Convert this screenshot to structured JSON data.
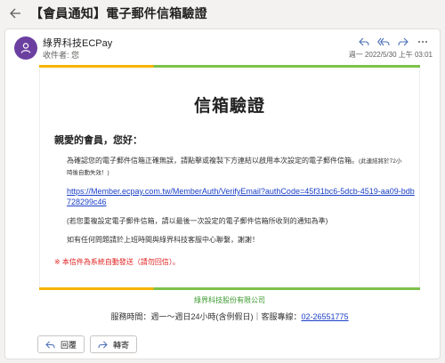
{
  "header": {
    "subject": "【會員通知】電子郵件信箱驗證"
  },
  "message": {
    "sender": "綠界科技ECPay",
    "recipient": "收件者: 您",
    "timestamp": "週一 2022/5/30 上午 03:01",
    "avatar_color": "#6b3fa0"
  },
  "email": {
    "title": "信箱驗證",
    "greeting": "親愛的會員，您好：",
    "paragraph1": "為確認您的電子郵件信箱正確無誤，請點擊或複製下方連結以啟用本次設定的電子郵件信箱。",
    "paragraph1_note": "(此連結將於72小時後自動失效！)",
    "verify_link": "https://Member.ecpay.com.tw/MemberAuth/VerifyEmail?authCode=45f31bc6-5dcb-4519-aa09-bdb728299c46",
    "paragraph2": "(若您重複設定電子郵件信箱，請以最後一次設定的電子郵件信箱所收到的通知為準)",
    "paragraph3": "如有任何問題請於上班時間與綠界科技客服中心聯繫，謝謝！",
    "notice": "※ 本信件為系統自動發送（請勿回信）。",
    "company": "綠界科技股份有限公司",
    "service_hours": "服務時間：週一～週日24小時(含例假日)｜客服專線：",
    "phone": "02-26551775",
    "accent_yellow": "#f5b400",
    "accent_green": "#7cc24a"
  },
  "buttons": {
    "reply": "回覆",
    "forward": "轉寄"
  },
  "icons": {
    "back": "arrow-left-icon",
    "reply": "reply-icon",
    "reply_all": "reply-all-icon",
    "forward": "forward-icon",
    "more": "more-icon"
  }
}
